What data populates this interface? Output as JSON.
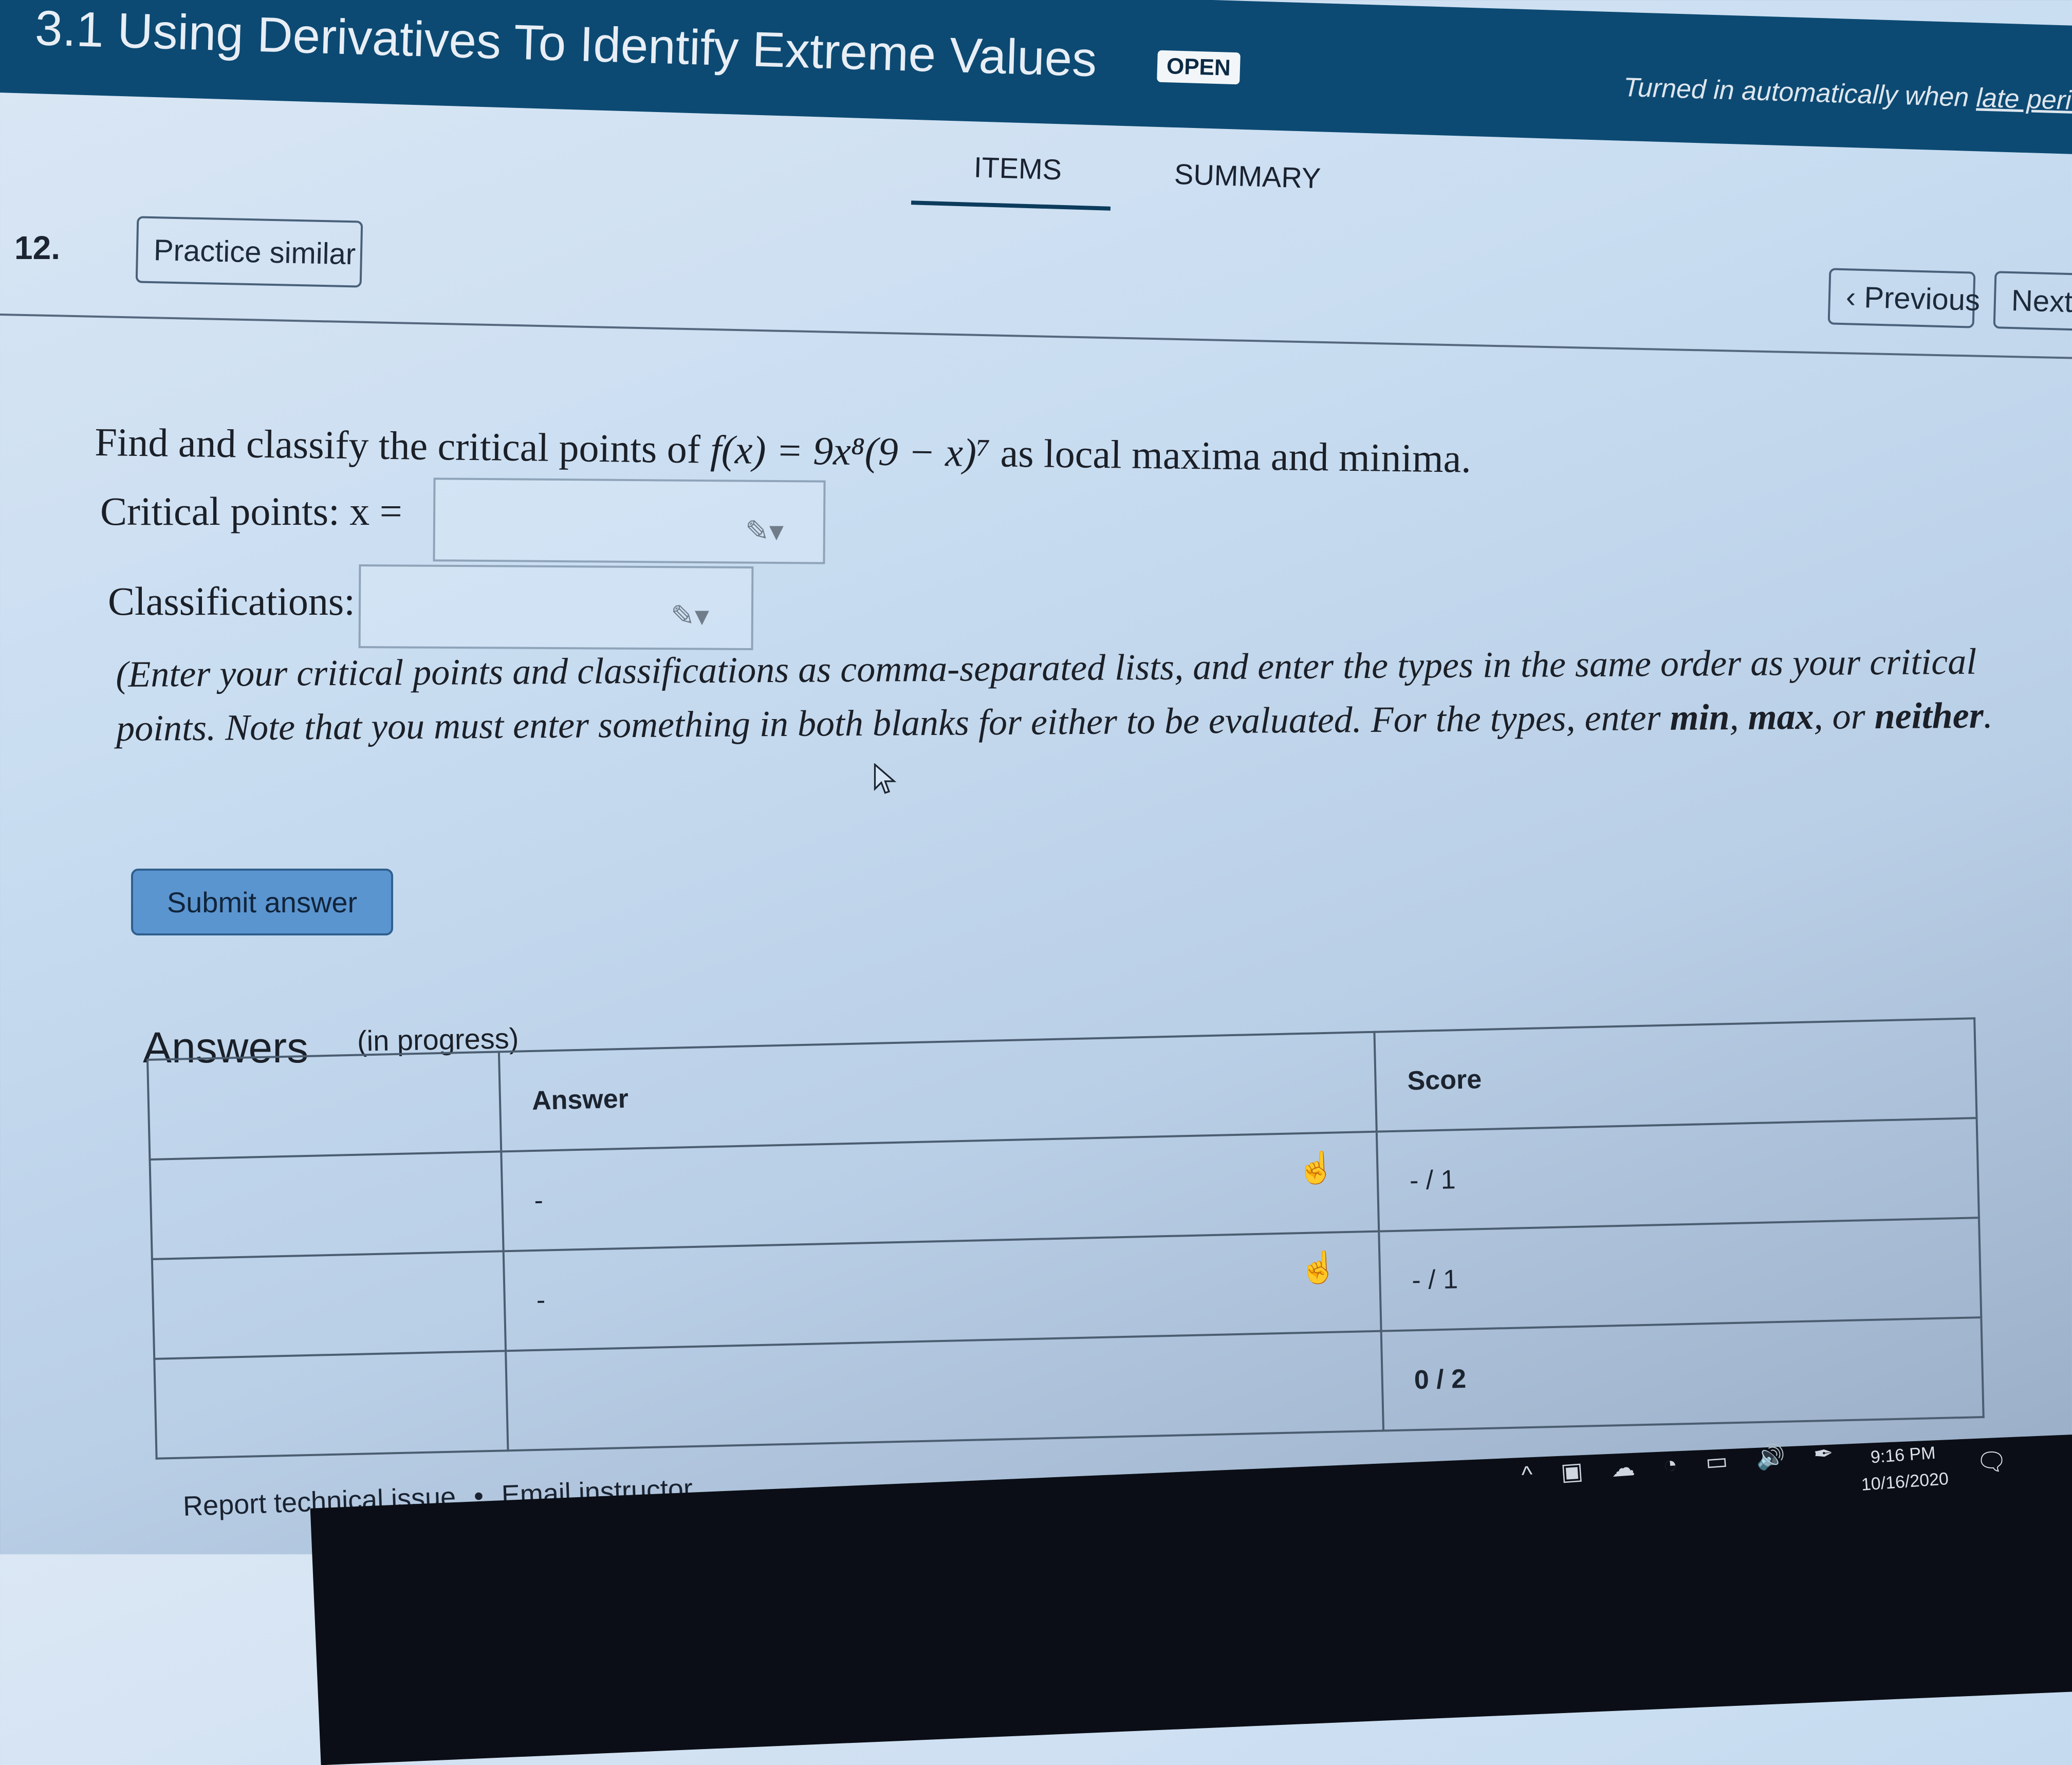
{
  "header": {
    "title": "3.1 Using Derivatives To Identify Extreme Values",
    "status_badge": "OPEN",
    "turned_in_prefix": "Turned in automatically when ",
    "turned_in_link": "late period e"
  },
  "tabs": [
    {
      "label": "ITEMS",
      "active": true
    },
    {
      "label": "SUMMARY",
      "active": false
    }
  ],
  "question": {
    "number": "12.",
    "practice_label": "Practice similar",
    "prev_label": "Previous",
    "next_label": "Next",
    "prompt_prefix": "Find and classify the critical points of ",
    "prompt_function": "f(x) = 9x⁸(9 − x)⁷",
    "prompt_suffix": " as local maxima and minima.",
    "critical_label": "Critical points: x =",
    "critical_value": "",
    "classification_label": "Classifications:",
    "classification_value": "",
    "note_part1": "(Enter your critical points and classifications as comma-separated lists, and enter the types in the same order as your critical points. Note that you must enter something in both blanks for either to be evaluated. For the types, enter ",
    "note_min": "min",
    "note_sep1": ", ",
    "note_max": "max",
    "note_sep2": ", or ",
    "note_neither": "neither",
    "note_end": ".",
    "submit_label": "Submit answer"
  },
  "answers": {
    "title": "Answers",
    "subtitle": "(in progress)",
    "headers": [
      "",
      "Answer",
      "Score"
    ],
    "rows": [
      {
        "label": "",
        "answer": "-",
        "score": "- / 1"
      },
      {
        "label": "",
        "answer": "-",
        "score": "- / 1"
      },
      {
        "label": "",
        "answer": "",
        "score": "0 / 2"
      }
    ]
  },
  "footer": {
    "report": "Report technical issue",
    "separator": "•",
    "email": "Email instructor"
  },
  "taskbar": {
    "time": "9:16 PM",
    "date": "10/16/2020"
  }
}
